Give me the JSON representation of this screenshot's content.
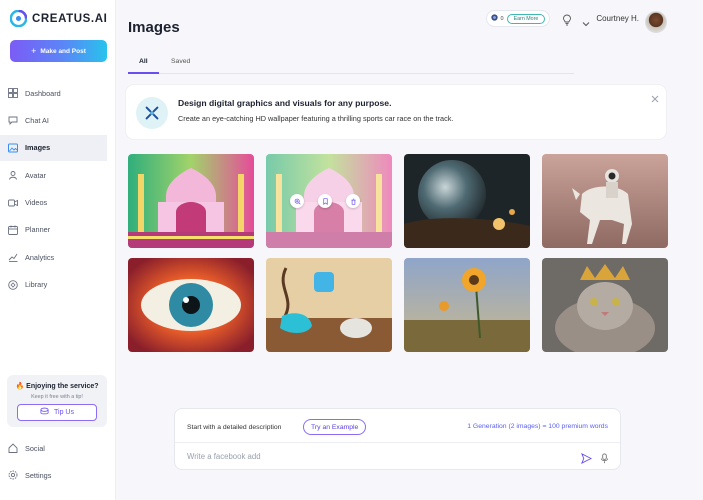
{
  "app": {
    "brand": "CREATUS.AI"
  },
  "sidebar": {
    "make_button": "Make and Post",
    "items": [
      {
        "label": "Dashboard",
        "icon": "dashboard-icon"
      },
      {
        "label": "Chat AI",
        "icon": "chat-icon"
      },
      {
        "label": "Images",
        "icon": "image-icon",
        "active": true
      },
      {
        "label": "Avatar",
        "icon": "avatar-icon"
      },
      {
        "label": "Videos",
        "icon": "video-icon"
      },
      {
        "label": "Planner",
        "icon": "calendar-icon"
      },
      {
        "label": "Analytics",
        "icon": "analytics-icon"
      },
      {
        "label": "Library",
        "icon": "library-icon"
      }
    ],
    "promo": {
      "title": "Enjoying the service?",
      "subtitle": "Keep it free with a tip!",
      "button": "Tip Us"
    },
    "bottom_items": [
      {
        "label": "Social",
        "icon": "social-icon"
      },
      {
        "label": "Settings",
        "icon": "gear-icon"
      }
    ]
  },
  "header": {
    "title": "Images",
    "credits": "0",
    "earn_button": "Earn More",
    "user_name": "Courtney H."
  },
  "tabs": [
    {
      "label": "All",
      "active": true
    },
    {
      "label": "Saved",
      "active": false
    }
  ],
  "banner": {
    "title": "Design digital graphics and visuals for any purpose.",
    "subtitle": "Create an eye-catching HD wallpaper featuring a thrilling sports car race on the track."
  },
  "gallery": [
    {
      "name": "taj-mahal-neon"
    },
    {
      "name": "taj-mahal-neon-hover"
    },
    {
      "name": "fantasy-portal-planet"
    },
    {
      "name": "astronaut-on-horse"
    },
    {
      "name": "colorful-eye"
    },
    {
      "name": "melting-watches"
    },
    {
      "name": "sunflower-field"
    },
    {
      "name": "cat-with-crown"
    }
  ],
  "composer": {
    "hint": "Start with a detailed description",
    "example_button": "Try an Example",
    "generation_info": "1 Generation (2 images) = 100 premium words",
    "placeholder": "Write a facebook add"
  },
  "colors": {
    "accent": "#6a4ff0",
    "gradient_start": "#7b5cf5",
    "gradient_end": "#28c3ec",
    "earn_border": "#3fb7b3"
  }
}
